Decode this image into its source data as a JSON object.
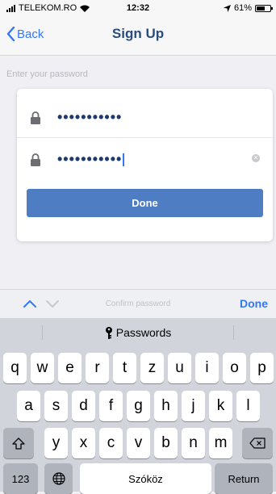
{
  "status_bar": {
    "carrier": "TELEKOM.RO",
    "time": "12:32",
    "battery": "61%"
  },
  "nav": {
    "back_label": "Back",
    "title": "Sign Up"
  },
  "form": {
    "hint": "Enter your password",
    "password_value": "•••••••••••",
    "confirm_value": "•••••••••••",
    "done_label": "Done"
  },
  "accessory": {
    "field_label": "Confirm password",
    "done_label": "Done"
  },
  "keyboard": {
    "suggestion": "Passwords",
    "row1": [
      "q",
      "w",
      "e",
      "r",
      "t",
      "z",
      "u",
      "i",
      "o",
      "p"
    ],
    "row2": [
      "a",
      "s",
      "d",
      "f",
      "g",
      "h",
      "j",
      "k",
      "l"
    ],
    "row3": [
      "y",
      "x",
      "c",
      "v",
      "b",
      "n",
      "m"
    ],
    "numbers_label": "123",
    "space_label": "Szóköz",
    "return_label": "Return"
  },
  "colors": {
    "accent": "#3478f6",
    "button": "#4e7dc4",
    "title": "#2a4c7d"
  }
}
